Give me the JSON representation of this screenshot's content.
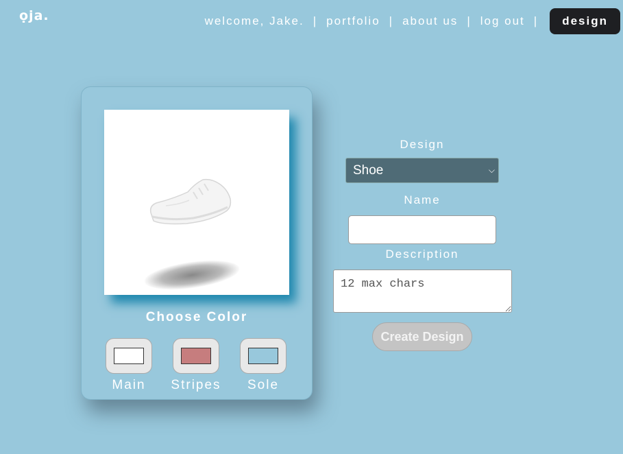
{
  "header": {
    "logo": "ọja.",
    "welcome": "welcome, Jake.",
    "separator": "|",
    "nav": {
      "portfolio": "portfolio",
      "about": "about us",
      "logout": "log out",
      "design": "design"
    }
  },
  "preview": {
    "image_icon": "sneaker-icon"
  },
  "colors": {
    "title": "Choose Color",
    "swatches": [
      {
        "label": "Main",
        "color": "#ffffff"
      },
      {
        "label": "Stripes",
        "color": "#c67d7e"
      },
      {
        "label": "Sole",
        "color": "#98c8dc"
      }
    ]
  },
  "form": {
    "design_label": "Design",
    "design_selected": "Shoe",
    "name_label": "Name",
    "name_value": "",
    "description_label": "Description",
    "description_placeholder": "12 max chars",
    "create_label": "Create Design"
  }
}
